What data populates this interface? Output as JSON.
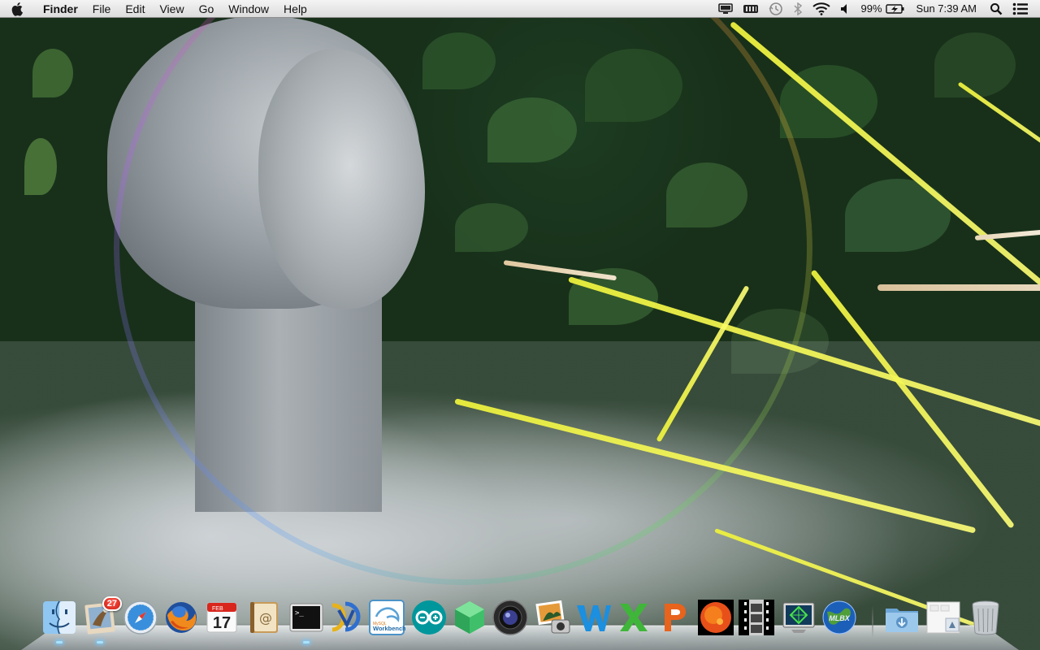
{
  "menubar": {
    "apple_icon": "apple-icon",
    "app_name": "Finder",
    "menus": [
      "File",
      "Edit",
      "View",
      "Go",
      "Window",
      "Help"
    ],
    "status": {
      "battery_percent": "99%",
      "clock": "Sun 7:39 AM"
    }
  },
  "dock": {
    "apps": [
      {
        "name": "Finder",
        "icon": "finder-icon",
        "running": true
      },
      {
        "name": "Mail",
        "icon": "mail-icon",
        "badge": "27",
        "running": true
      },
      {
        "name": "Safari",
        "icon": "safari-icon",
        "running": false
      },
      {
        "name": "Firefox",
        "icon": "firefox-icon",
        "running": false
      },
      {
        "name": "iCal",
        "icon": "calendar-icon",
        "calendar_month": "FEB",
        "calendar_day": "17",
        "running": false
      },
      {
        "name": "Address Book",
        "icon": "address-book-icon",
        "running": false
      },
      {
        "name": "Terminal",
        "icon": "terminal-icon",
        "running": true
      },
      {
        "name": "Fetch",
        "icon": "ftp-icon",
        "running": false
      },
      {
        "name": "MySQL Workbench",
        "icon": "mysql-workbench-icon",
        "label_top": "MySQL",
        "label_bottom": "Workbench",
        "running": false
      },
      {
        "name": "Arduino",
        "icon": "arduino-icon",
        "running": false
      },
      {
        "name": "SketchUp",
        "icon": "cube-icon",
        "running": false
      },
      {
        "name": "Aperture",
        "icon": "lens-icon",
        "running": false
      },
      {
        "name": "iPhoto",
        "icon": "photo-icon",
        "running": false
      },
      {
        "name": "Word",
        "icon": "word-icon",
        "running": false
      },
      {
        "name": "Excel",
        "icon": "excel-icon",
        "running": false
      },
      {
        "name": "PowerPoint",
        "icon": "powerpoint-icon",
        "running": false
      },
      {
        "name": "Solar",
        "icon": "sun-icon",
        "running": false
      },
      {
        "name": "Film Viewer",
        "icon": "filmstrip-icon",
        "running": false
      },
      {
        "name": "Network Utility",
        "icon": "monitor-target-icon",
        "running": false
      },
      {
        "name": "MLBX",
        "icon": "globe-icon",
        "globe_label": "MLBX",
        "running": false
      },
      {
        "name": "Downloads",
        "icon": "downloads-folder-icon",
        "running": false
      },
      {
        "name": "Documents",
        "icon": "documents-stack-icon",
        "running": false
      },
      {
        "name": "Trash",
        "icon": "trash-icon",
        "running": false
      }
    ]
  },
  "colors": {
    "menubar_top": "#f4f4f4",
    "menubar_bottom": "#dcdcdc",
    "badge_red": "#e0241a",
    "running_light": "#aae6ff"
  }
}
